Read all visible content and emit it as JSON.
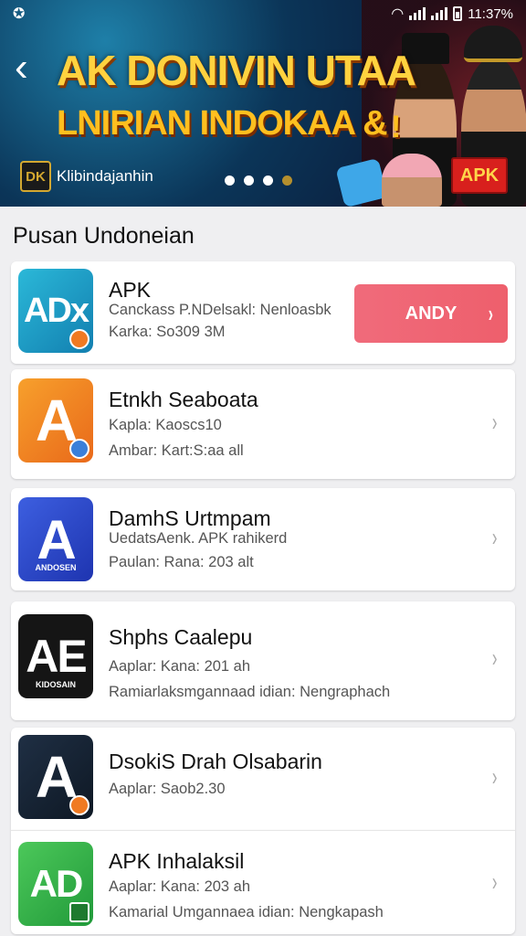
{
  "status_bar": {
    "time": "11:37%"
  },
  "banner": {
    "title": "AK DONIVIN UTAA",
    "subtitle": "LNIRIAN INDOKAA &",
    "brand_logo": "DK",
    "brand_text": "Klibindajanhin",
    "badge": "APK",
    "slides": 4,
    "active_slide": 4
  },
  "section": {
    "title": "Pusan Undoneian"
  },
  "apps": [
    {
      "name": "APK",
      "line1": "Canckass P.NDelsakl: Nenloasbk",
      "line2": "Karka: So309 3M",
      "icon_text": "ADx",
      "icon_color": "#1fa2c8",
      "button_label": "ANDY"
    },
    {
      "name": "Etnkh Seaboata",
      "line1": "Kapla: Kaoscs10",
      "line2": "Ambar: Kart:S:aa all",
      "icon_text": "A",
      "icon_color": "#f08a1c"
    },
    {
      "name": "DamhS Urtmpam",
      "line1": "UedatsAenk. APK   rahikerd",
      "line2": "Paulan: Rana: 203 alt",
      "icon_text": "A",
      "icon_color": "#2a46c8",
      "icon_sub": "ANDOSEN"
    },
    {
      "name": "Shphs Caalepu",
      "line1": "Aaplar: Kana: 201 ah",
      "line2": "Ramiarlaksmgannaad idian: Nengraphach",
      "icon_text": "AE",
      "icon_color": "#151515",
      "icon_sub": "KIDOSAIN"
    },
    {
      "name": "DsokiS Drah Olsabarin",
      "line1": "Aaplar: Saob2.30",
      "line2": "",
      "icon_text": "A",
      "icon_color": "#1a2a3a"
    },
    {
      "name": "APK Inhalaksil",
      "line1": "Aaplar: Kana: 203 ah",
      "line2": "Kamarial Umgannaea idian: Nengkapash",
      "icon_text": "AD",
      "icon_color": "#2fb44a"
    }
  ]
}
